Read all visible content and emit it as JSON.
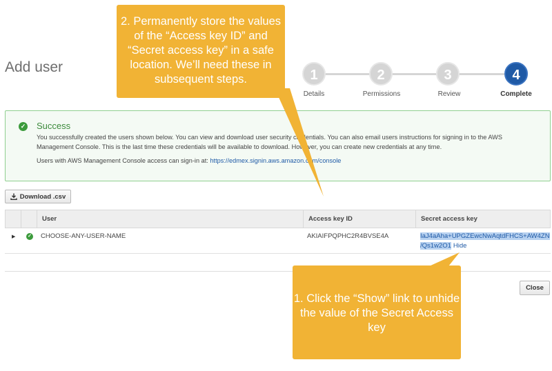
{
  "page": {
    "title": "Add user"
  },
  "wizard": {
    "steps": [
      {
        "number": "1",
        "label": "Details",
        "active": false
      },
      {
        "number": "2",
        "label": "Permissions",
        "active": false
      },
      {
        "number": "3",
        "label": "Review",
        "active": false
      },
      {
        "number": "4",
        "label": "Complete",
        "active": true
      }
    ]
  },
  "success": {
    "title": "Success",
    "message": "You successfully created the users shown below. You can view and download user security credentials. You can also email users instructions for signing in to the AWS Management Console. This is the last time these credentials will be available to download. However, you can create new credentials at any time.",
    "signin_prefix": "Users with AWS Management Console access can sign-in at:",
    "signin_url": "https://edmex.signin.aws.amazon.com/console"
  },
  "toolbar": {
    "download_label": "Download .csv"
  },
  "table": {
    "columns": [
      "User",
      "Access key ID",
      "Secret access key"
    ],
    "rows": [
      {
        "user": "CHOOSE-ANY-USER-NAME",
        "access_key_id": "AKIAIFPQPHC2R4BVSE4A",
        "secret_line1": "IaJ4aAha+UPGZEwcNwAqtdFHCS+AW4ZN",
        "secret_line2": "/Qs1w2O1",
        "hide_label": "Hide"
      }
    ]
  },
  "footer": {
    "close_label": "Close"
  },
  "annotations": {
    "top": "2. Permanently store the values of the “Access key ID” and “Secret access key” in a safe location. We’ll need these in subsequent steps.",
    "bottom": "1. Click the “Show” link to unhide the value of the Secret Access key"
  },
  "colors": {
    "accent": "#1f5aa6",
    "success": "#3c9b3c",
    "callout": "#f1b335"
  },
  "icons": {
    "success": "check-circle-icon",
    "download": "download-icon",
    "expand": "caret-right-icon"
  }
}
